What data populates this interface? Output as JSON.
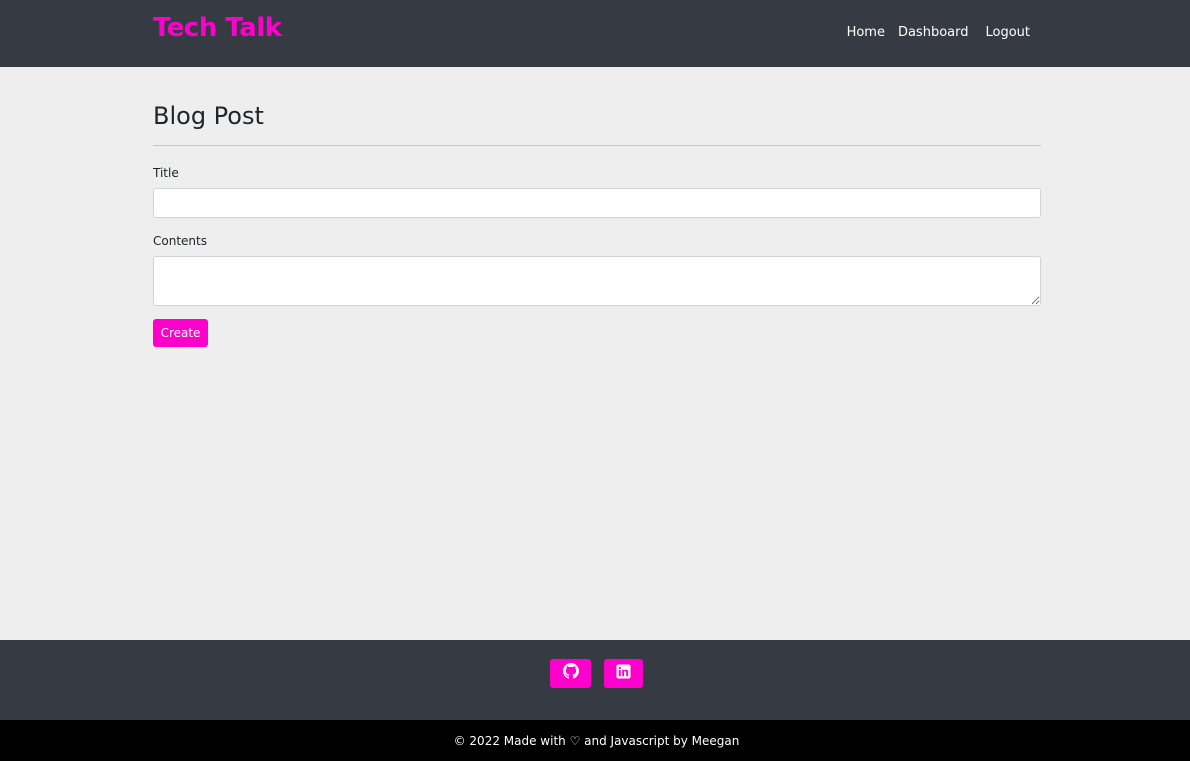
{
  "header": {
    "brand": "Tech Talk",
    "nav": {
      "home": "Home",
      "dashboard": "Dashboard",
      "logout": "Logout"
    }
  },
  "main": {
    "title": "Blog Post",
    "form": {
      "title_label": "Title",
      "title_value": "",
      "contents_label": "Contents",
      "contents_value": "",
      "submit_label": "Create"
    }
  },
  "footer": {
    "social": [
      {
        "icon": "github-icon"
      },
      {
        "icon": "linkedin-icon"
      }
    ],
    "copyright": "© 2022 Made with ♡ and Javascript by Meegan"
  },
  "colors": {
    "accent": "#ff00cc",
    "header_bg": "#353a43",
    "page_bg": "#eeeeee",
    "bottom_bar_bg": "#000000"
  }
}
